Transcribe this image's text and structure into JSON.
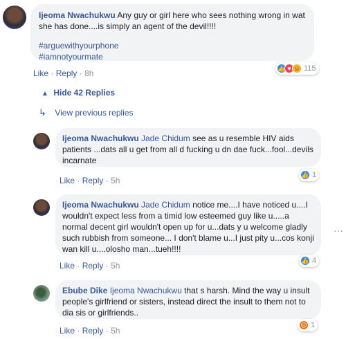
{
  "main_comment": {
    "author": "Ijeoma Nwachukwu",
    "text": "Any guy or girl here who sees nothing wrong in wat she has done....is simply an agent of the devil!!!!",
    "hashtags": [
      "#arguewithyourphone",
      "#iamnotyourmate"
    ],
    "actions": {
      "like": "Like",
      "reply": "Reply",
      "time": "8h"
    },
    "reactions": {
      "types": [
        "like-icon",
        "love-icon",
        "haha-icon"
      ],
      "count": "115"
    }
  },
  "thread_controls": {
    "hide_label": "Hide 42 Replies",
    "previous_label": "View previous replies"
  },
  "replies": [
    {
      "author": "Ijeoma Nwachukwu",
      "mention": "Jade Chidum",
      "text": "see as u resemble HIV aids patients ...dats all u get from all d fucking u dn dae fuck...fool...devils incarnate",
      "actions": {
        "like": "Like",
        "reply": "Reply",
        "time": "5h"
      },
      "reactions": {
        "types": [
          "like-icon"
        ],
        "count": "1"
      }
    },
    {
      "author": "Ijeoma Nwachukwu",
      "mention": "Jade Chidum",
      "text": "notice me....I have noticed u....I wouldn't expect less from a timid low esteemed guy like u.....a normal decent girl wouldn't open up for u...dats y u welcome gladly such rubbish from someone... I don't blame u...I just pity u...cos konji wan kill u....olosho man...tueh!!!!",
      "actions": {
        "like": "Like",
        "reply": "Reply",
        "time": "5h"
      },
      "reactions": {
        "types": [
          "like-icon"
        ],
        "count": "4"
      }
    },
    {
      "author": "Ebube Dike",
      "mention": "Ijeoma Nwachukwu",
      "text": "that s harsh. Mind the way u insult people's girlfriend or sisters, instead direct the insult to them not to dia sis or girlfriends..",
      "actions": {
        "like": "Like",
        "reply": "Reply",
        "time": "5h"
      },
      "reactions": {
        "types": [
          "angry-icon"
        ],
        "count": "1"
      }
    }
  ],
  "more_icon": "more-options-icon",
  "colors": {
    "link": "#385898",
    "bubble": "#f2f3f5",
    "meta": "#90949c"
  }
}
